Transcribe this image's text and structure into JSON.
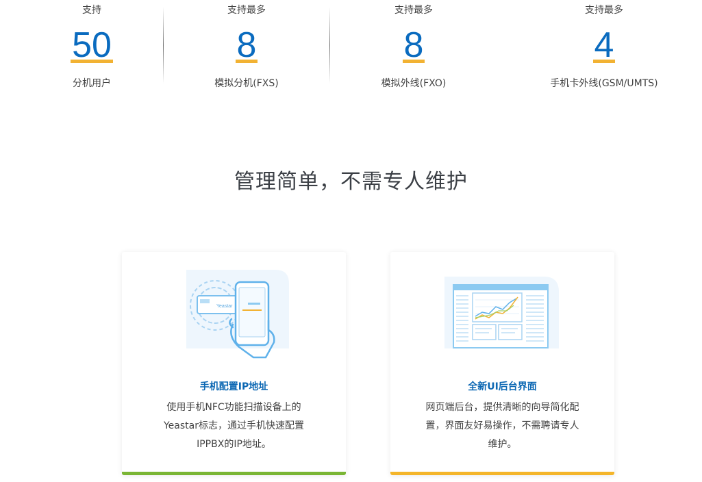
{
  "stats": [
    {
      "pre": "支持",
      "number": "50",
      "post": "分机用户"
    },
    {
      "pre": "支持最多",
      "number": "8",
      "post": "模拟分机(FXS)"
    },
    {
      "pre": "支持最多",
      "number": "8",
      "post": "模拟外线(FXO)"
    },
    {
      "pre": "支持最多",
      "number": "4",
      "post": "手机卡外线(GSM/UMTS)"
    }
  ],
  "section": {
    "title": "管理简单，不需专人维护"
  },
  "cards": [
    {
      "title": "手机配置IP地址",
      "desc": "使用手机NFC功能扫描设备上的Yeastar标志，通过手机快速配置IPPBX的IP地址。",
      "illus_brand": "Yeastar",
      "illus_icon": "phone-nfc-illustration",
      "bar_color": "#7ab534"
    },
    {
      "title": "全新UI后台界面",
      "desc": "网页端后台，提供清晰的向导简化配置，界面友好易操作，不需聘请专人维护。",
      "illus_icon": "web-dashboard-illustration",
      "bar_color": "#f4b52a"
    }
  ],
  "colors": {
    "number": "#0a6bbf",
    "underline": "#f2b233",
    "card_title": "#0b67b3"
  }
}
